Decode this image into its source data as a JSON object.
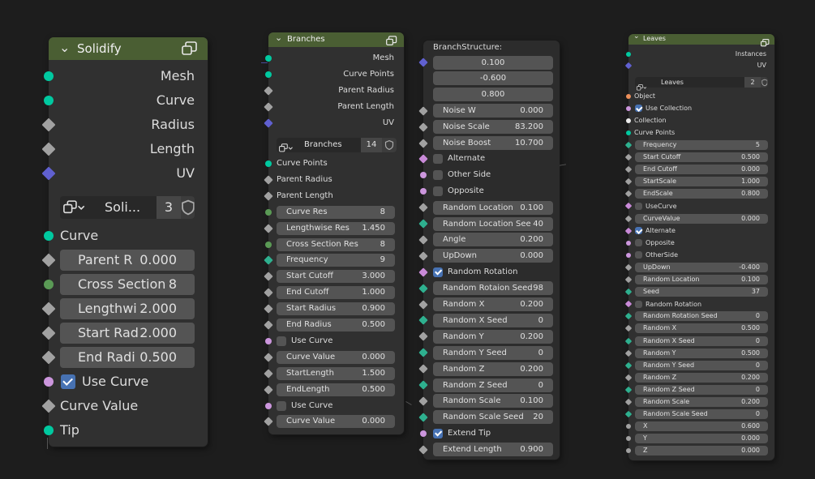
{
  "solidify": {
    "title": "Solidify",
    "outputs": [
      {
        "label": "Mesh",
        "socket": "geometry"
      },
      {
        "label": "Curve",
        "socket": "geometry"
      },
      {
        "label": "Radius",
        "socket": "float"
      },
      {
        "label": "Length",
        "socket": "float"
      },
      {
        "label": "UV",
        "socket": "vector"
      }
    ],
    "datablock": {
      "name": "Soli...",
      "count": "3"
    },
    "inputs": [
      {
        "kind": "label",
        "label": "Curve",
        "socket": "geometry"
      },
      {
        "kind": "field",
        "name": "Parent R",
        "value": "0.000",
        "socket": "float"
      },
      {
        "kind": "field",
        "name": "Cross Section",
        "value": "8",
        "socket": "int"
      },
      {
        "kind": "field",
        "name": "Lengthwi",
        "value": "2.000",
        "socket": "float"
      },
      {
        "kind": "field",
        "name": "Start Rad",
        "value": "2.000",
        "socket": "float"
      },
      {
        "kind": "field",
        "name": "End Radi",
        "value": "0.500",
        "socket": "float"
      },
      {
        "kind": "check",
        "label": "Use Curve",
        "checked": true,
        "socket": "bool"
      },
      {
        "kind": "label",
        "label": "Curve Value",
        "socket": "float"
      },
      {
        "kind": "label",
        "label": "Tip",
        "socket": "geometry"
      }
    ]
  },
  "branches": {
    "title": "Branches",
    "outputs": [
      {
        "label": "Mesh",
        "socket": "geometry"
      },
      {
        "label": "Curve Points",
        "socket": "geometry"
      },
      {
        "label": "Parent Radius",
        "socket": "float"
      },
      {
        "label": "Parent Length",
        "socket": "float"
      },
      {
        "label": "UV",
        "socket": "vector"
      }
    ],
    "datablock": {
      "name": "Branches",
      "count": "14"
    },
    "inputs": [
      {
        "kind": "label",
        "label": "Curve Points",
        "socket": "geometry"
      },
      {
        "kind": "label",
        "label": "Parent Radius",
        "socket": "float"
      },
      {
        "kind": "label",
        "label": "Parent Length",
        "socket": "float"
      },
      {
        "kind": "field",
        "name": "Curve Res",
        "value": "8",
        "socket": "int"
      },
      {
        "kind": "field",
        "name": "Lengthwise Res",
        "value": "1.450",
        "socket": "float"
      },
      {
        "kind": "field",
        "name": "Cross Section Res",
        "value": "8",
        "socket": "int"
      },
      {
        "kind": "field",
        "name": "Frequency",
        "value": "9",
        "socket": "intd"
      },
      {
        "kind": "field",
        "name": "Start Cutoff",
        "value": "3.000",
        "socket": "float"
      },
      {
        "kind": "field",
        "name": "End Cutoff",
        "value": "1.000",
        "socket": "float"
      },
      {
        "kind": "field",
        "name": "Start Radius",
        "value": "0.900",
        "socket": "float"
      },
      {
        "kind": "field",
        "name": "End Radius",
        "value": "0.500",
        "socket": "float"
      },
      {
        "kind": "check",
        "label": "Use Curve",
        "checked": false,
        "socket": "bool"
      },
      {
        "kind": "field",
        "name": "Curve Value",
        "value": "0.000",
        "socket": "float"
      },
      {
        "kind": "field",
        "name": "StartLength",
        "value": "1.500",
        "socket": "float"
      },
      {
        "kind": "field",
        "name": "EndLength",
        "value": "0.500",
        "socket": "float"
      },
      {
        "kind": "check",
        "label": "Use Curve",
        "checked": false,
        "socket": "bool"
      },
      {
        "kind": "field",
        "name": "Curve Value",
        "value": "0.000",
        "socket": "float"
      }
    ]
  },
  "branch_structure": {
    "title": "BranchStructure:",
    "inputs": [
      {
        "kind": "vec",
        "value": "0.100",
        "socket": "vector"
      },
      {
        "kind": "vec",
        "value": "-0.600",
        "socket": "none"
      },
      {
        "kind": "vec",
        "value": "0.800",
        "socket": "none"
      },
      {
        "kind": "field",
        "name": "Noise W",
        "value": "0.000",
        "socket": "float"
      },
      {
        "kind": "field",
        "name": "Noise Scale",
        "value": "83.200",
        "socket": "float"
      },
      {
        "kind": "field",
        "name": "Noise Boost",
        "value": "10.700",
        "socket": "float"
      },
      {
        "kind": "check",
        "label": "Alternate",
        "checked": false,
        "socket": "boold"
      },
      {
        "kind": "check",
        "label": "Other Side",
        "checked": false,
        "socket": "bool"
      },
      {
        "kind": "check",
        "label": "Opposite",
        "checked": false,
        "socket": "bool"
      },
      {
        "kind": "field",
        "name": "Random Location",
        "value": "0.100",
        "socket": "float"
      },
      {
        "kind": "field",
        "name": "Random Location See",
        "value": "40",
        "socket": "intd"
      },
      {
        "kind": "field",
        "name": "Angle",
        "value": "0.200",
        "socket": "float"
      },
      {
        "kind": "field",
        "name": "UpDown",
        "value": "0.000",
        "socket": "float"
      },
      {
        "kind": "check",
        "label": "Random Rotation",
        "checked": true,
        "socket": "boold"
      },
      {
        "kind": "field",
        "name": "Random Rotaion Seed",
        "value": "98",
        "socket": "intd"
      },
      {
        "kind": "field",
        "name": "Random X",
        "value": "0.200",
        "socket": "float"
      },
      {
        "kind": "field",
        "name": "Random X Seed",
        "value": "0",
        "socket": "intd"
      },
      {
        "kind": "field",
        "name": "Random Y",
        "value": "0.200",
        "socket": "float"
      },
      {
        "kind": "field",
        "name": "Random Y Seed",
        "value": "0",
        "socket": "intd"
      },
      {
        "kind": "field",
        "name": "Random Z",
        "value": "0.200",
        "socket": "float"
      },
      {
        "kind": "field",
        "name": "Random Z Seed",
        "value": "0",
        "socket": "intd"
      },
      {
        "kind": "field",
        "name": "Random Scale",
        "value": "0.100",
        "socket": "float"
      },
      {
        "kind": "field",
        "name": "Random Scale Seed",
        "value": "20",
        "socket": "intd"
      },
      {
        "kind": "check",
        "label": "Extend Tip",
        "checked": true,
        "socket": "bool"
      },
      {
        "kind": "field",
        "name": "Extend Length",
        "value": "0.900",
        "socket": "float"
      }
    ]
  },
  "leaves": {
    "title": "Leaves",
    "outputs": [
      {
        "label": "Instances",
        "socket": "geometry"
      },
      {
        "label": "UV",
        "socket": "vector"
      }
    ],
    "datablock": {
      "name": "Leaves",
      "count": "2"
    },
    "inputs": [
      {
        "kind": "label",
        "label": "Object",
        "socket": "object"
      },
      {
        "kind": "check",
        "label": "Use Collection",
        "checked": true,
        "socket": "bool"
      },
      {
        "kind": "label",
        "label": "Collection",
        "socket": "collection"
      },
      {
        "kind": "label",
        "label": "Curve Points",
        "socket": "geometry"
      },
      {
        "kind": "field",
        "name": "Frequency",
        "value": "5",
        "socket": "intd"
      },
      {
        "kind": "field",
        "name": "Start Cutoff",
        "value": "0.500",
        "socket": "float"
      },
      {
        "kind": "field",
        "name": "End Cutoff",
        "value": "0.000",
        "socket": "float"
      },
      {
        "kind": "field",
        "name": "StartScale",
        "value": "1.000",
        "socket": "float"
      },
      {
        "kind": "field",
        "name": "EndScale",
        "value": "0.800",
        "socket": "float"
      },
      {
        "kind": "check",
        "label": "UseCurve",
        "checked": false,
        "socket": "boold"
      },
      {
        "kind": "field",
        "name": "CurveValue",
        "value": "0.000",
        "socket": "float"
      },
      {
        "kind": "check",
        "label": "Alternate",
        "checked": true,
        "socket": "boold"
      },
      {
        "kind": "check",
        "label": "Opposite",
        "checked": false,
        "socket": "bool"
      },
      {
        "kind": "check",
        "label": "OtherSide",
        "checked": false,
        "socket": "bool"
      },
      {
        "kind": "field",
        "name": "UpDown",
        "value": "-0.400",
        "socket": "float"
      },
      {
        "kind": "field",
        "name": "Random Location",
        "value": "0.100",
        "socket": "float"
      },
      {
        "kind": "field",
        "name": "Seed",
        "value": "37",
        "socket": "intd"
      },
      {
        "kind": "check",
        "label": "Random Rotation",
        "checked": false,
        "socket": "boold"
      },
      {
        "kind": "field",
        "name": "Random Rotation Seed",
        "value": "0",
        "socket": "intd"
      },
      {
        "kind": "field",
        "name": "Random X",
        "value": "0.500",
        "socket": "float"
      },
      {
        "kind": "field",
        "name": "Random X Seed",
        "value": "0",
        "socket": "intd"
      },
      {
        "kind": "field",
        "name": "Random Y",
        "value": "0.500",
        "socket": "float"
      },
      {
        "kind": "field",
        "name": "Random Y Seed",
        "value": "0",
        "socket": "intd"
      },
      {
        "kind": "field",
        "name": "Random Z",
        "value": "0.200",
        "socket": "float"
      },
      {
        "kind": "field",
        "name": "Random Z Seed",
        "value": "0",
        "socket": "intd"
      },
      {
        "kind": "field",
        "name": "Random Scale",
        "value": "0.200",
        "socket": "float"
      },
      {
        "kind": "field",
        "name": "Random Scale Seed",
        "value": "0",
        "socket": "intd"
      },
      {
        "kind": "field",
        "name": "X",
        "value": "0.600",
        "socket": "grey"
      },
      {
        "kind": "field",
        "name": "Y",
        "value": "0.000",
        "socket": "grey"
      },
      {
        "kind": "field",
        "name": "Z",
        "value": "0.000",
        "socket": "grey"
      }
    ]
  },
  "colors": {
    "background": "#1d1d1d",
    "node_body": "#303030",
    "header_geometry": "#4a5e33",
    "socket_geometry": "#00c9a0",
    "socket_float": "#a1a1a1",
    "socket_vector": "#6060d0",
    "socket_bool": "#cc96dd",
    "socket_int": "#5a9a55",
    "checkbox_on": "#4772b3",
    "field": "#545454"
  }
}
